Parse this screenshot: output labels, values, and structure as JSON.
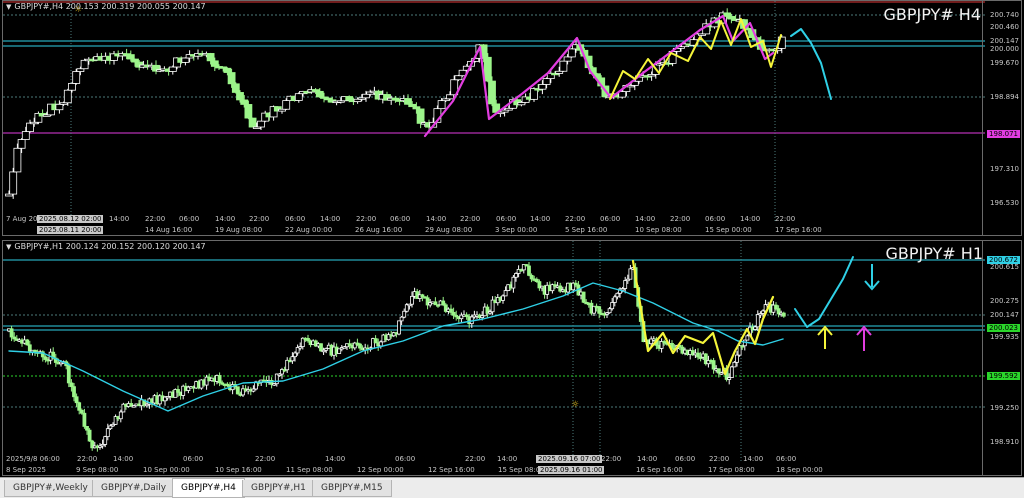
{
  "colors": {
    "bull": "#ffffff",
    "bear": "#9cf58a",
    "ma": "#2fd0e6",
    "zigzag_magenta": "#e23de0",
    "zigzag_yellow": "#f5f53a",
    "level_cyan": "#2fd0e6",
    "level_magenta": "#e23de0",
    "level_green": "#2bd62b",
    "level_red": "#e03a3a",
    "grid": "#4c7a7a"
  },
  "icons": {
    "chart_menu": "triangle-down-icon",
    "crosshair": "crosshair-icon"
  },
  "top_chart": {
    "header": "GBPJPY#,H4  200.153 200.319 200.055 200.147",
    "watermark": "GBPJPY#  H4",
    "prices": [
      {
        "text": "200.740",
        "tag": "none"
      },
      {
        "text": "200.460",
        "tag": "none"
      },
      {
        "text": "200.147",
        "tag": "none"
      },
      {
        "text": "200.000",
        "tag": "none"
      },
      {
        "text": "199.670",
        "tag": "none"
      },
      {
        "text": "198.894",
        "tag": "none"
      },
      {
        "text": "198.071",
        "tag": "magenta"
      },
      {
        "text": "197.310",
        "tag": "none"
      },
      {
        "text": "196.530",
        "tag": "none"
      }
    ],
    "times": [
      "7 Aug 20",
      "2025.08.12 02:00",
      "2025.08.11 20:00",
      "14:00",
      "22:00",
      "06:00",
      "14:00",
      "22:00",
      "06:00",
      "14:00",
      "22:00",
      "06:00",
      "14:00",
      "22:00",
      "06:00",
      "14:00",
      "22:00",
      "06:00",
      "14:00",
      "22:00",
      "06:00",
      "14:00",
      "22:00"
    ],
    "dates": [
      "14 Aug 16:00",
      "19 Aug 08:00",
      "22 Aug 00:00",
      "26 Aug 16:00",
      "29 Aug 08:00",
      "3 Sep 00:00",
      "5 Sep 16:00",
      "10 Sep 08:00",
      "15 Sep 00:00",
      "17 Sep 16:00"
    ]
  },
  "bottom_chart": {
    "header": "GBPJPY#,H1  200.124 200.152 200.120 200.147",
    "watermark": "GBPJPY#  H1",
    "prices": [
      {
        "text": "200.672",
        "tag": "cyan"
      },
      {
        "text": "200.615",
        "tag": "none"
      },
      {
        "text": "200.275",
        "tag": "none"
      },
      {
        "text": "200.147",
        "tag": "none"
      },
      {
        "text": "200.023",
        "tag": "green"
      },
      {
        "text": "199.935",
        "tag": "none"
      },
      {
        "text": "199.592",
        "tag": "green"
      },
      {
        "text": "199.250",
        "tag": "none"
      },
      {
        "text": "198.910",
        "tag": "none"
      }
    ],
    "times": [
      "2025/9/8 06:00",
      "22:00",
      "14:00",
      "06:00",
      "22:00",
      "14:00",
      "06:00",
      "22:00",
      "14:00",
      "06:00",
      "22:00",
      "14:00",
      "2025.09.16 07:00",
      "14:00",
      "06:00",
      "22:00",
      "14:00",
      "22:00",
      "06:00"
    ],
    "dates": [
      "8 Sep 2025",
      "9 Sep 08:00",
      "10 Sep 00:00",
      "10 Sep 16:00",
      "11 Sep 08:00",
      "12 Sep 00:00",
      "12 Sep 16:00",
      "15 Sep 08:00",
      "2025.09.16 01:00",
      "16 Sep 16:00",
      "17 Sep 08:00",
      "18 Sep 00:00"
    ]
  },
  "tabs": [
    {
      "label": "GBPJPY#,Weekly",
      "active": false
    },
    {
      "label": "GBPJPY#,Daily",
      "active": false
    },
    {
      "label": "GBPJPY#,H4",
      "active": true
    },
    {
      "label": "GBPJPY#,H1",
      "active": false
    },
    {
      "label": "GBPJPY#,M15",
      "active": false
    }
  ]
}
